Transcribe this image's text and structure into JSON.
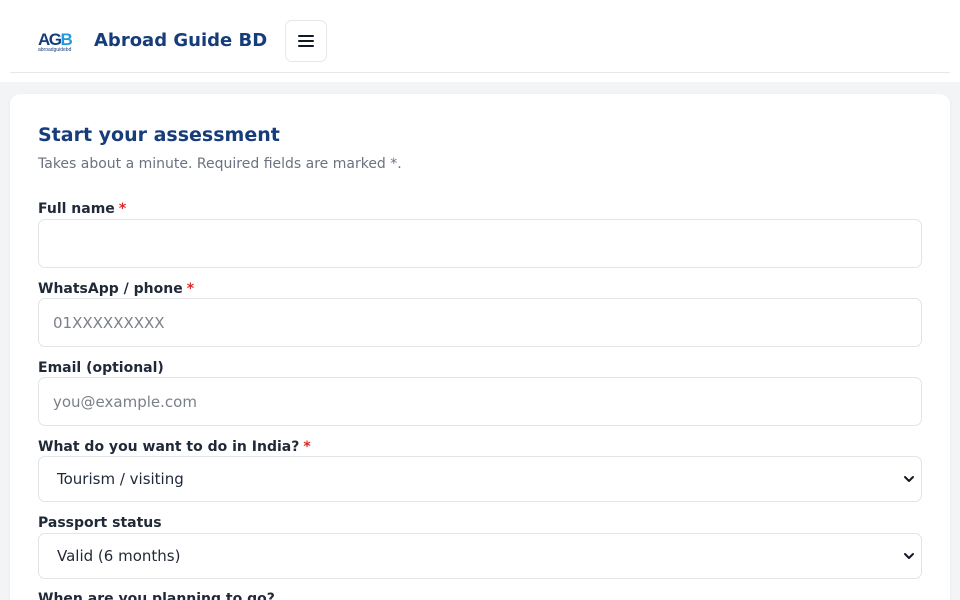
{
  "header": {
    "logo_text": "AGB",
    "logo_subtext": "abroadguidebd",
    "brand": "Abroad Guide BD",
    "menu_icon": "hamburger-icon"
  },
  "form": {
    "title": "Start your assessment",
    "subtitle": "Takes about a minute. Required fields are marked *.",
    "required_mark": "*",
    "fields": [
      {
        "label": "Full name",
        "required": true,
        "value": "",
        "placeholder": ""
      },
      {
        "label": "WhatsApp / phone",
        "required": true,
        "value": "",
        "placeholder": "01XXXXXXXXX"
      },
      {
        "label": "Email (optional)",
        "required": false,
        "value": "",
        "placeholder": "you@example.com"
      }
    ],
    "purpose": {
      "label": "What do you want to do in India?",
      "required": true,
      "selected": "Tourism / visiting"
    },
    "passport": {
      "label": "Passport status",
      "required": false,
      "selected": "Valid (6 months)"
    },
    "timing": {
      "label": "When are you planning to go?"
    }
  },
  "colors": {
    "brand": "#163d7a",
    "logo_blue": "#1e9be0",
    "required": "#dc2626"
  }
}
